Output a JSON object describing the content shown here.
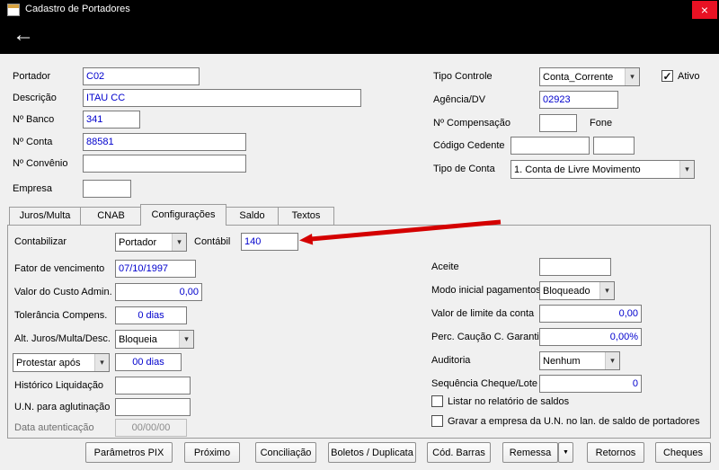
{
  "window": {
    "title": "Cadastro de Portadores"
  },
  "icons": {
    "close": "×",
    "back": "←",
    "combo_arrow": "▾",
    "check": "✓",
    "dropdown": "▼"
  },
  "colors": {
    "titlebar_bg": "#000000",
    "close_button_bg": "#E81123",
    "input_text": "#0000CD",
    "annotation_arrow": "#D40000",
    "window_bg": "#F0F0F0"
  },
  "top_form": {
    "portador": {
      "label": "Portador",
      "value": "C02"
    },
    "descricao": {
      "label": "Descrição",
      "value": "ITAU CC"
    },
    "banco": {
      "label": "Nº Banco",
      "value": "341"
    },
    "conta": {
      "label": "Nº Conta",
      "value": "88581"
    },
    "convenio": {
      "label": "Nº Convênio",
      "value": ""
    },
    "empresa": {
      "label": "Empresa",
      "value": ""
    },
    "tipo_controle": {
      "label": "Tipo Controle",
      "value": "Conta_Corrente"
    },
    "ativo": {
      "label": "Ativo",
      "checked": true
    },
    "agencia": {
      "label": "Agência/DV",
      "value": "02923"
    },
    "compensacao": {
      "label": "Nº Compensação",
      "value": ""
    },
    "fone": {
      "label": "Fone",
      "value": ""
    },
    "cedente": {
      "label": "Código Cedente",
      "value": ""
    },
    "tipo_conta": {
      "label": "Tipo de Conta",
      "value": "1. Conta de Livre Movimento"
    }
  },
  "tabs": {
    "items": [
      {
        "label": "Juros/Multa",
        "selected": false
      },
      {
        "label": "CNAB",
        "selected": false
      },
      {
        "label": "Configurações",
        "selected": true
      },
      {
        "label": "Saldo",
        "selected": false
      },
      {
        "label": "Textos",
        "selected": false
      }
    ]
  },
  "config": {
    "contabilizar": {
      "label": "Contabilizar",
      "value": "Portador"
    },
    "contabil": {
      "label": "Contábil",
      "value": "140"
    },
    "fator_vencimento": {
      "label": "Fator de vencimento",
      "value": "07/10/1997"
    },
    "custo_admin": {
      "label": "Valor do Custo Admin.",
      "value": "0,00"
    },
    "tolerancia": {
      "label": "Tolerância Compens.",
      "value": "0 dias"
    },
    "alt_juros": {
      "label": "Alt. Juros/Multa/Desc.",
      "value": "Bloqueia"
    },
    "protestar": {
      "label": "Protestar após",
      "value": "00 dias"
    },
    "historico": {
      "label": "Histórico Liquidação",
      "value": ""
    },
    "un_aglutinacao": {
      "label": "U.N. para aglutinação",
      "value": ""
    },
    "data_autenticacao": {
      "label": "Data autenticação",
      "value": "00/00/00"
    },
    "aceite": {
      "label": "Aceite",
      "value": ""
    },
    "modo_pagamentos": {
      "label": "Modo inicial pagamentos",
      "value": "Bloqueado"
    },
    "limite_conta": {
      "label": "Valor de limite da conta",
      "value": "0,00"
    },
    "caucao": {
      "label": "Perc. Caução C. Garantida",
      "value": "0,00%"
    },
    "auditoria": {
      "label": "Auditoria",
      "value": "Nenhum"
    },
    "sequencia": {
      "label": "Sequência Cheque/Lote",
      "value": "0"
    },
    "listar_saldos": {
      "label": "Listar no relatório de saldos",
      "checked": false
    },
    "gravar_empresa": {
      "label": "Gravar a empresa da U.N. no lan. de saldo de portadores",
      "checked": false
    }
  },
  "buttons": {
    "items": [
      {
        "label": "Parâmetros PIX"
      },
      {
        "label": "Próximo"
      },
      {
        "label": "Conciliação"
      },
      {
        "label": "Boletos / Duplicata"
      },
      {
        "label": "Cód. Barras"
      },
      {
        "label": "Remessa"
      },
      {
        "label": "Retornos"
      },
      {
        "label": "Cheques"
      }
    ]
  }
}
